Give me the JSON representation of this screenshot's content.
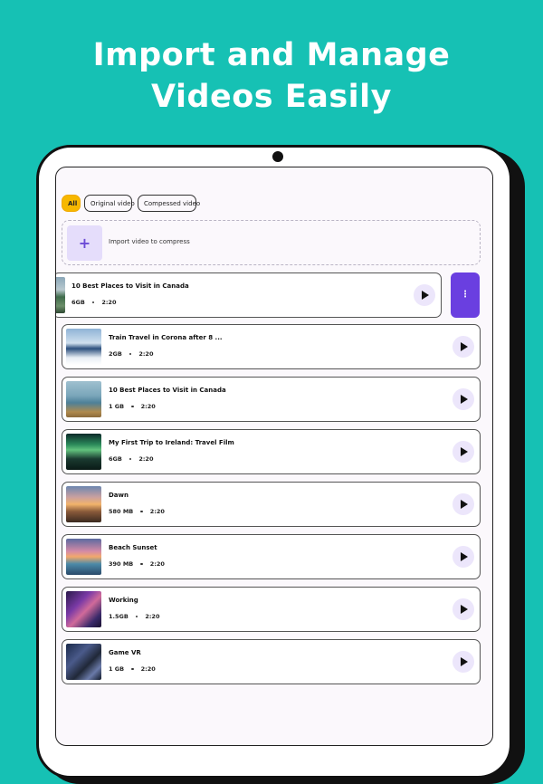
{
  "headline": {
    "line1": "Import and Manage",
    "line2": "Videos Easily"
  },
  "filters": [
    {
      "label": "All",
      "active": true
    },
    {
      "label": "Original video",
      "active": false
    },
    {
      "label": "Compessed video",
      "active": false
    }
  ],
  "import": {
    "label": "Import video to compress",
    "icon": "+"
  },
  "swiped_item": {
    "title": "10 Best Places to Visit in Canada",
    "size": "6GB",
    "duration": "2:20",
    "more_icon": "⋮"
  },
  "videos": [
    {
      "title": "Train Travel in Corona after 8 ...",
      "size": "2GB",
      "duration": "2:20"
    },
    {
      "title": "10 Best Places to Visit in Canada",
      "size": "1 GB",
      "duration": "2:20"
    },
    {
      "title": "My First Trip to Ireland: Travel Film",
      "size": "6GB",
      "duration": "2:20"
    },
    {
      "title": "Dawn",
      "size": "580 MB",
      "duration": "2:20"
    },
    {
      "title": "Beach Sunset",
      "size": "390 MB",
      "duration": "2:20"
    },
    {
      "title": "Working",
      "size": "1.5GB",
      "duration": "2:20"
    },
    {
      "title": "Game VR",
      "size": "1 GB",
      "duration": "2:20"
    }
  ],
  "colors": {
    "background": "#16c1b4",
    "accent": "#6a3fe0",
    "chip_active": "#f7b800",
    "play_bg": "#ece6fb"
  }
}
